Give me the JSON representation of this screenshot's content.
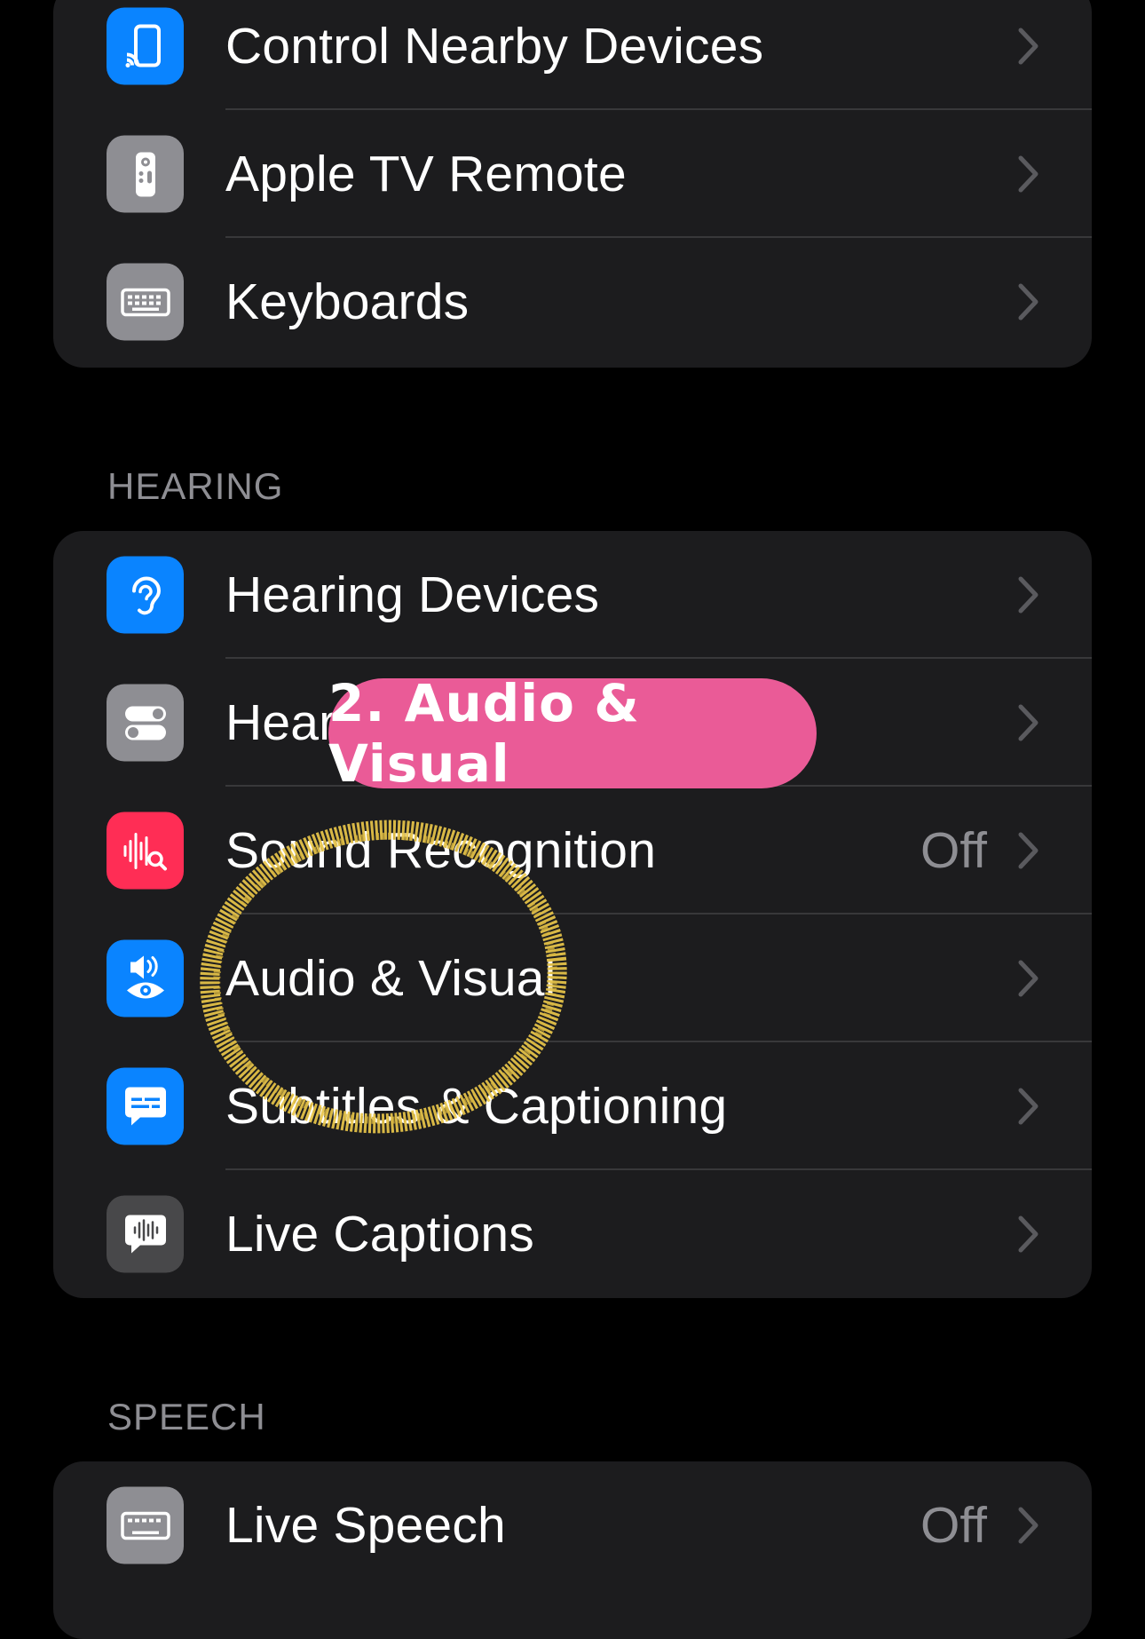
{
  "colors": {
    "background": "#000000",
    "group_bg": "#1c1c1e",
    "separator": "#38383a",
    "secondary_text": "#8e8e93",
    "blue": "#0a84ff",
    "gray": "#8e8e93",
    "pink_red": "#ff2d55",
    "annotation_pill": "#ea5b97",
    "annotation_circle": "#e8c64a"
  },
  "group1": {
    "items": [
      {
        "label": "Control Nearby Devices",
        "icon": "nearby-devices-icon"
      },
      {
        "label": "Apple TV Remote",
        "icon": "tv-remote-icon"
      },
      {
        "label": "Keyboards",
        "icon": "keyboard-icon"
      }
    ]
  },
  "hearing": {
    "header": "HEARING",
    "items": [
      {
        "label": "Hearing Devices",
        "icon": "ear-icon"
      },
      {
        "label": "Hear",
        "icon": "toggles-icon"
      },
      {
        "label": "Sound Recognition",
        "value": "Off",
        "icon": "sound-recognition-icon"
      },
      {
        "label": "Audio & Visual",
        "icon": "speaker-eye-icon"
      },
      {
        "label": "Subtitles & Captioning",
        "icon": "captions-bubble-icon"
      },
      {
        "label": "Live Captions",
        "icon": "live-captions-icon"
      }
    ]
  },
  "speech": {
    "header": "SPEECH",
    "items": [
      {
        "label": "Live Speech",
        "value": "Off",
        "icon": "keyboard-icon"
      }
    ]
  },
  "annotation": {
    "pill_text": "2. Audio & Visual"
  }
}
